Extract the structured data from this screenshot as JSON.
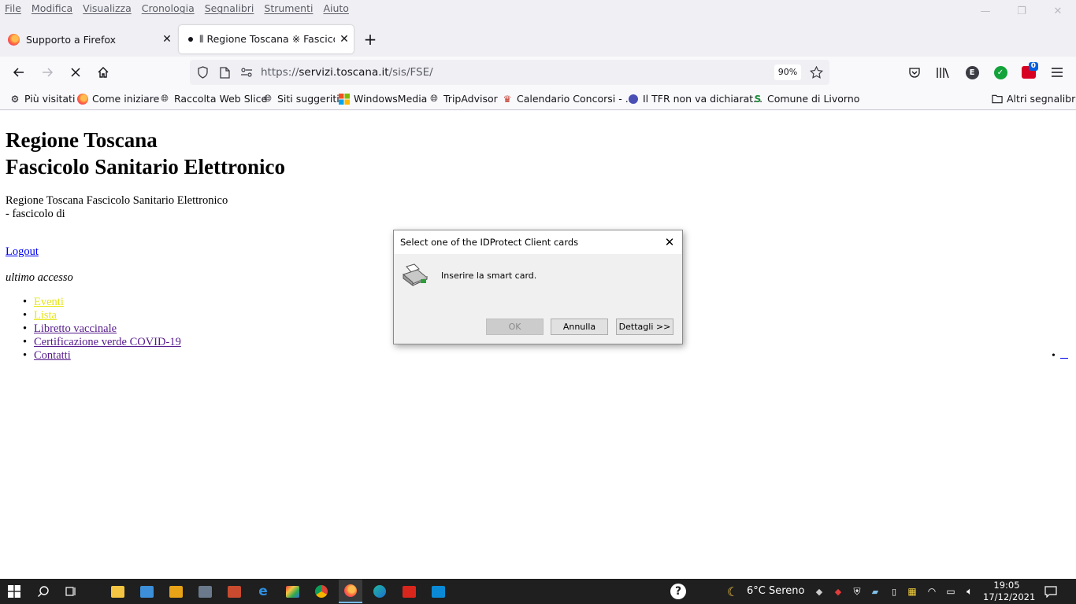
{
  "menubar": {
    "items": [
      "File",
      "Modifica",
      "Visualizza",
      "Cronologia",
      "Segnalibri",
      "Strumenti",
      "Aiuto"
    ]
  },
  "tabs": [
    {
      "label": "Supporto a Firefox"
    },
    {
      "label": "⦀ Regione Toscana ※ Fascicolo"
    }
  ],
  "navbar": {
    "url_prefix": "https://",
    "url_domain": "servizi.toscana.it",
    "url_path": "/sis/FSE/",
    "zoom": "90%",
    "extension_badge": "0",
    "account_initial": "E"
  },
  "bookmarks": {
    "items": [
      {
        "label": "Più visitati",
        "icon": "gear-icon"
      },
      {
        "label": "Come iniziare",
        "icon": "firefox-icon"
      },
      {
        "label": "Raccolta Web Slice",
        "icon": "globe-icon"
      },
      {
        "label": "Siti suggeriti",
        "icon": "globe-icon"
      },
      {
        "label": "WindowsMedia",
        "icon": "windows-icon"
      },
      {
        "label": "TripAdvisor",
        "icon": "globe-icon"
      },
      {
        "label": "Calendario Concorsi - ...",
        "icon": "emblem-icon"
      },
      {
        "label": "Il TFR non va dichiarat...",
        "icon": "moon-icon"
      },
      {
        "label": "Comune di Livorno",
        "icon": "livorno-icon"
      }
    ],
    "other": "Altri segnalibri"
  },
  "page": {
    "heading_line1": "Regione Toscana",
    "heading_line2": "Fascicolo Sanitario Elettronico",
    "subtitle_line1": "Regione Toscana Fascicolo Sanitario Elettronico",
    "subtitle_line2": "- fascicolo di",
    "logout": "Logout",
    "last_access": "ultimo accesso",
    "nav": [
      "Eventi",
      "Lista",
      "Libretto vaccinale",
      "Certificazione verde COVID-19",
      "Contatti"
    ]
  },
  "dialog": {
    "title": "Select one of the IDProtect Client cards",
    "message": "Inserire la smart card.",
    "ok": "OK",
    "cancel": "Annulla",
    "details": "Dettagli >>"
  },
  "taskbar": {
    "weather": "6°C  Sereno",
    "time": "19:05",
    "date": "17/12/2021"
  },
  "colors": {
    "chrome_bg": "#f0f0f4",
    "link": "#0000ee",
    "visited_link": "#551a8b",
    "highlight_link": "#e6e619",
    "taskbar": "#1f1f1f"
  }
}
